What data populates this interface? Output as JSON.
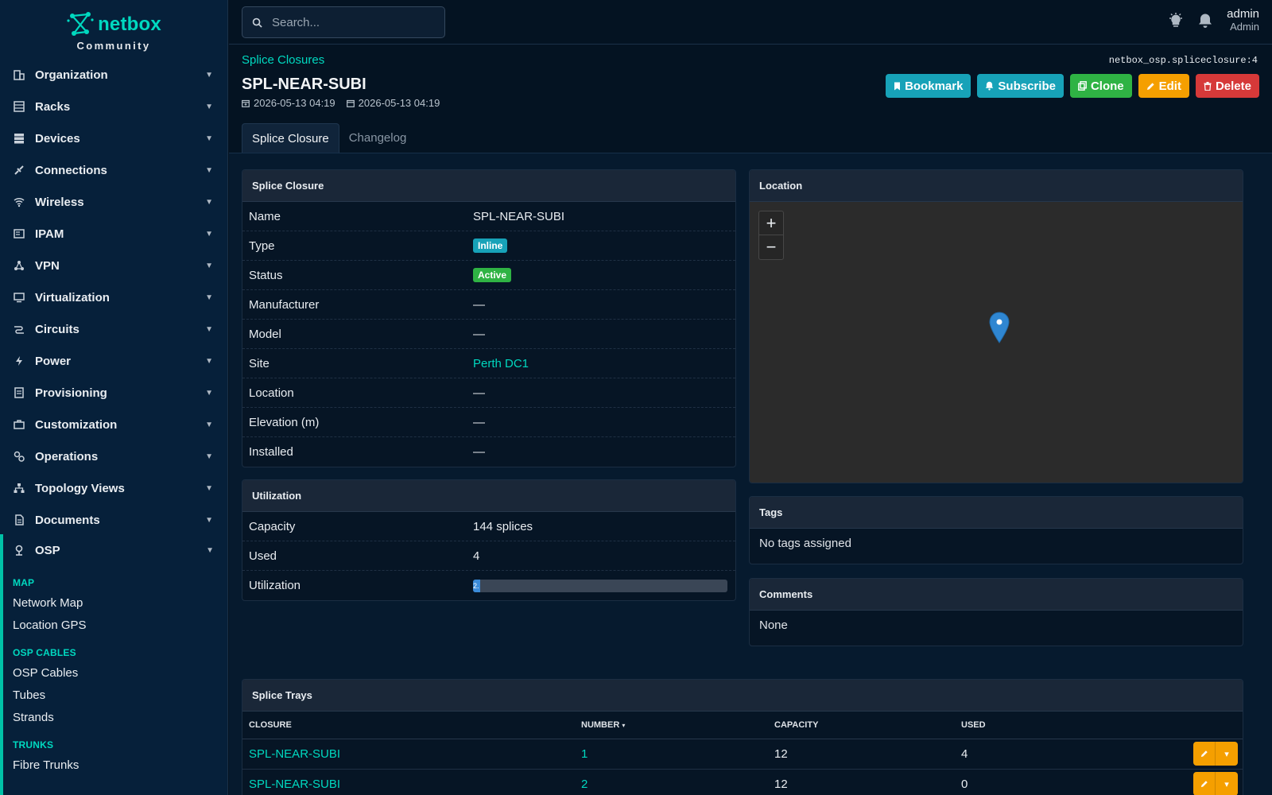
{
  "brand": {
    "name": "netbox",
    "sub": "Community"
  },
  "sidebar": {
    "items": [
      {
        "label": "Organization",
        "icon": "organization-icon"
      },
      {
        "label": "Racks",
        "icon": "racks-icon"
      },
      {
        "label": "Devices",
        "icon": "devices-icon"
      },
      {
        "label": "Connections",
        "icon": "connections-icon"
      },
      {
        "label": "Wireless",
        "icon": "wireless-icon"
      },
      {
        "label": "IPAM",
        "icon": "ipam-icon"
      },
      {
        "label": "VPN",
        "icon": "vpn-icon"
      },
      {
        "label": "Virtualization",
        "icon": "virtualization-icon"
      },
      {
        "label": "Circuits",
        "icon": "circuits-icon"
      },
      {
        "label": "Power",
        "icon": "power-icon"
      },
      {
        "label": "Provisioning",
        "icon": "provisioning-icon"
      },
      {
        "label": "Customization",
        "icon": "customization-icon"
      },
      {
        "label": "Operations",
        "icon": "operations-icon"
      },
      {
        "label": "Topology Views",
        "icon": "topology-icon"
      },
      {
        "label": "Documents",
        "icon": "documents-icon"
      }
    ],
    "osp": {
      "label": "OSP",
      "sections": {
        "map": {
          "head": "MAP",
          "items": [
            "Network Map",
            "Location GPS"
          ]
        },
        "cables": {
          "head": "OSP CABLES",
          "items": [
            "OSP Cables",
            "Tubes",
            "Strands"
          ]
        },
        "trunks": {
          "head": "TRUNKS",
          "items": [
            "Fibre Trunks"
          ]
        }
      }
    }
  },
  "topbar": {
    "search_placeholder": "Search...",
    "user_name": "admin",
    "user_role": "Admin"
  },
  "header": {
    "breadcrumb": "Splice Closures",
    "object_ref": "netbox_osp.spliceclosure:4",
    "title": "SPL-NEAR-SUBI",
    "created": "2026-05-13 04:19",
    "updated": "2026-05-13 04:19",
    "buttons": {
      "bookmark": "Bookmark",
      "subscribe": "Subscribe",
      "clone": "Clone",
      "edit": "Edit",
      "delete": "Delete"
    },
    "tabs": [
      "Splice Closure",
      "Changelog"
    ]
  },
  "closure": {
    "head": "Splice Closure",
    "rows": [
      {
        "k": "Name",
        "v": "SPL-NEAR-SUBI"
      },
      {
        "k": "Type",
        "v": "Inline"
      },
      {
        "k": "Status",
        "v": "Active"
      },
      {
        "k": "Manufacturer",
        "v": "—"
      },
      {
        "k": "Model",
        "v": "—"
      },
      {
        "k": "Site",
        "v": "Perth DC1"
      },
      {
        "k": "Location",
        "v": "—"
      },
      {
        "k": "Elevation (m)",
        "v": "—"
      },
      {
        "k": "Installed",
        "v": "—"
      }
    ],
    "type_color": "#17a2b8",
    "status_color": "#2fb344"
  },
  "utilization": {
    "head": "Utilization",
    "capacity_label": "Capacity",
    "capacity": "144 splices",
    "used_label": "Used",
    "used": "4",
    "util_label": "Utilization",
    "util_text": "2.",
    "util_percent": 2.8
  },
  "location": {
    "head": "Location",
    "zoom_in": "+",
    "zoom_out": "−"
  },
  "tags": {
    "head": "Tags",
    "text": "No tags assigned"
  },
  "comments": {
    "head": "Comments",
    "text": "None"
  },
  "trays": {
    "head": "Splice Trays",
    "columns": [
      "CLOSURE",
      "NUMBER",
      "CAPACITY",
      "USED"
    ],
    "rows": [
      {
        "closure": "SPL-NEAR-SUBI",
        "number": "1",
        "capacity": "12",
        "used": "4"
      },
      {
        "closure": "SPL-NEAR-SUBI",
        "number": "2",
        "capacity": "12",
        "used": "0"
      }
    ]
  },
  "colors": {
    "accent": "#00d9c0",
    "sidebar_bg": "#06203a",
    "page_bg": "#041322"
  }
}
